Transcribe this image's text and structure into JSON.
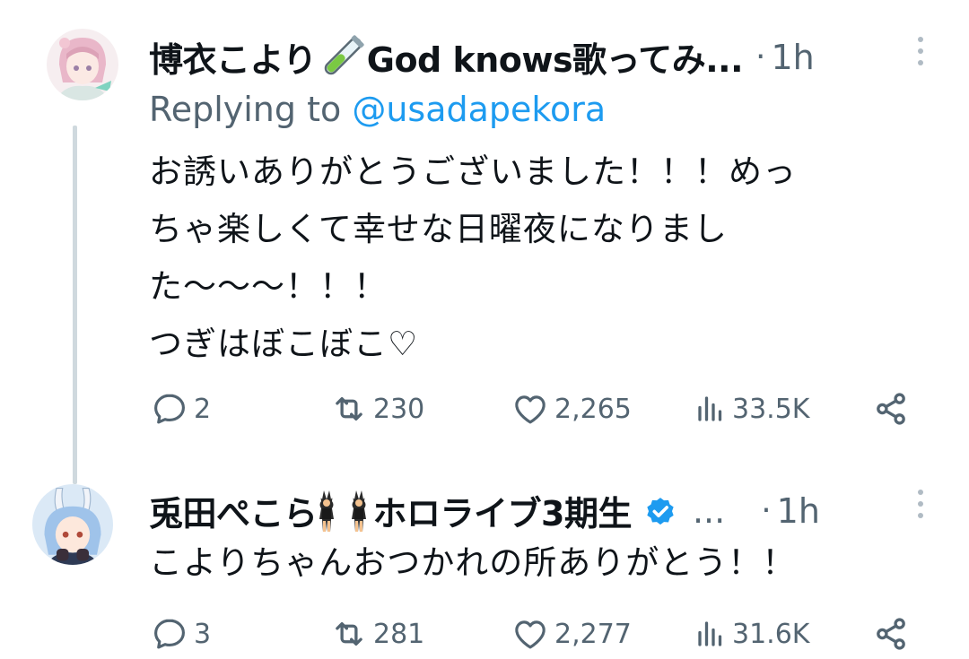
{
  "tweets": [
    {
      "author": "博衣こより",
      "author_suffix": "God knows歌ってみ...",
      "separator": "·",
      "time": "1h",
      "replying_prefix": "Replying to",
      "replying_handle": "@usadapekora",
      "body_lines": [
        "お誘いありがとうございました！！！めっ",
        "ちゃ楽しくて幸せな日曜夜になりまし",
        "た〜〜〜！！！",
        "つぎはぼこぼこ♡"
      ],
      "stats": {
        "replies": "2",
        "retweets": "230",
        "likes": "2,265",
        "views": "33.5K"
      }
    },
    {
      "author": "兎田ぺこら",
      "author_suffix": "ホロライブ3期生",
      "ellipsis": "...",
      "separator": "·",
      "time": "1h",
      "body_lines": [
        "こよりちゃんおつかれの所ありがとう！！"
      ],
      "stats": {
        "replies": "3",
        "retweets": "281",
        "likes": "2,277",
        "views": "31.6K"
      }
    }
  ],
  "colors": {
    "text": "#0f1419",
    "secondary": "#536471",
    "link": "#1d9bf0",
    "thread_line": "#cfd9de"
  },
  "icons": [
    "reply-icon",
    "retweet-icon",
    "like-icon",
    "views-icon",
    "share-icon",
    "verified-badge-icon",
    "test-tube-emoji",
    "bunny-dancers-emoji",
    "more-options-icon"
  ]
}
